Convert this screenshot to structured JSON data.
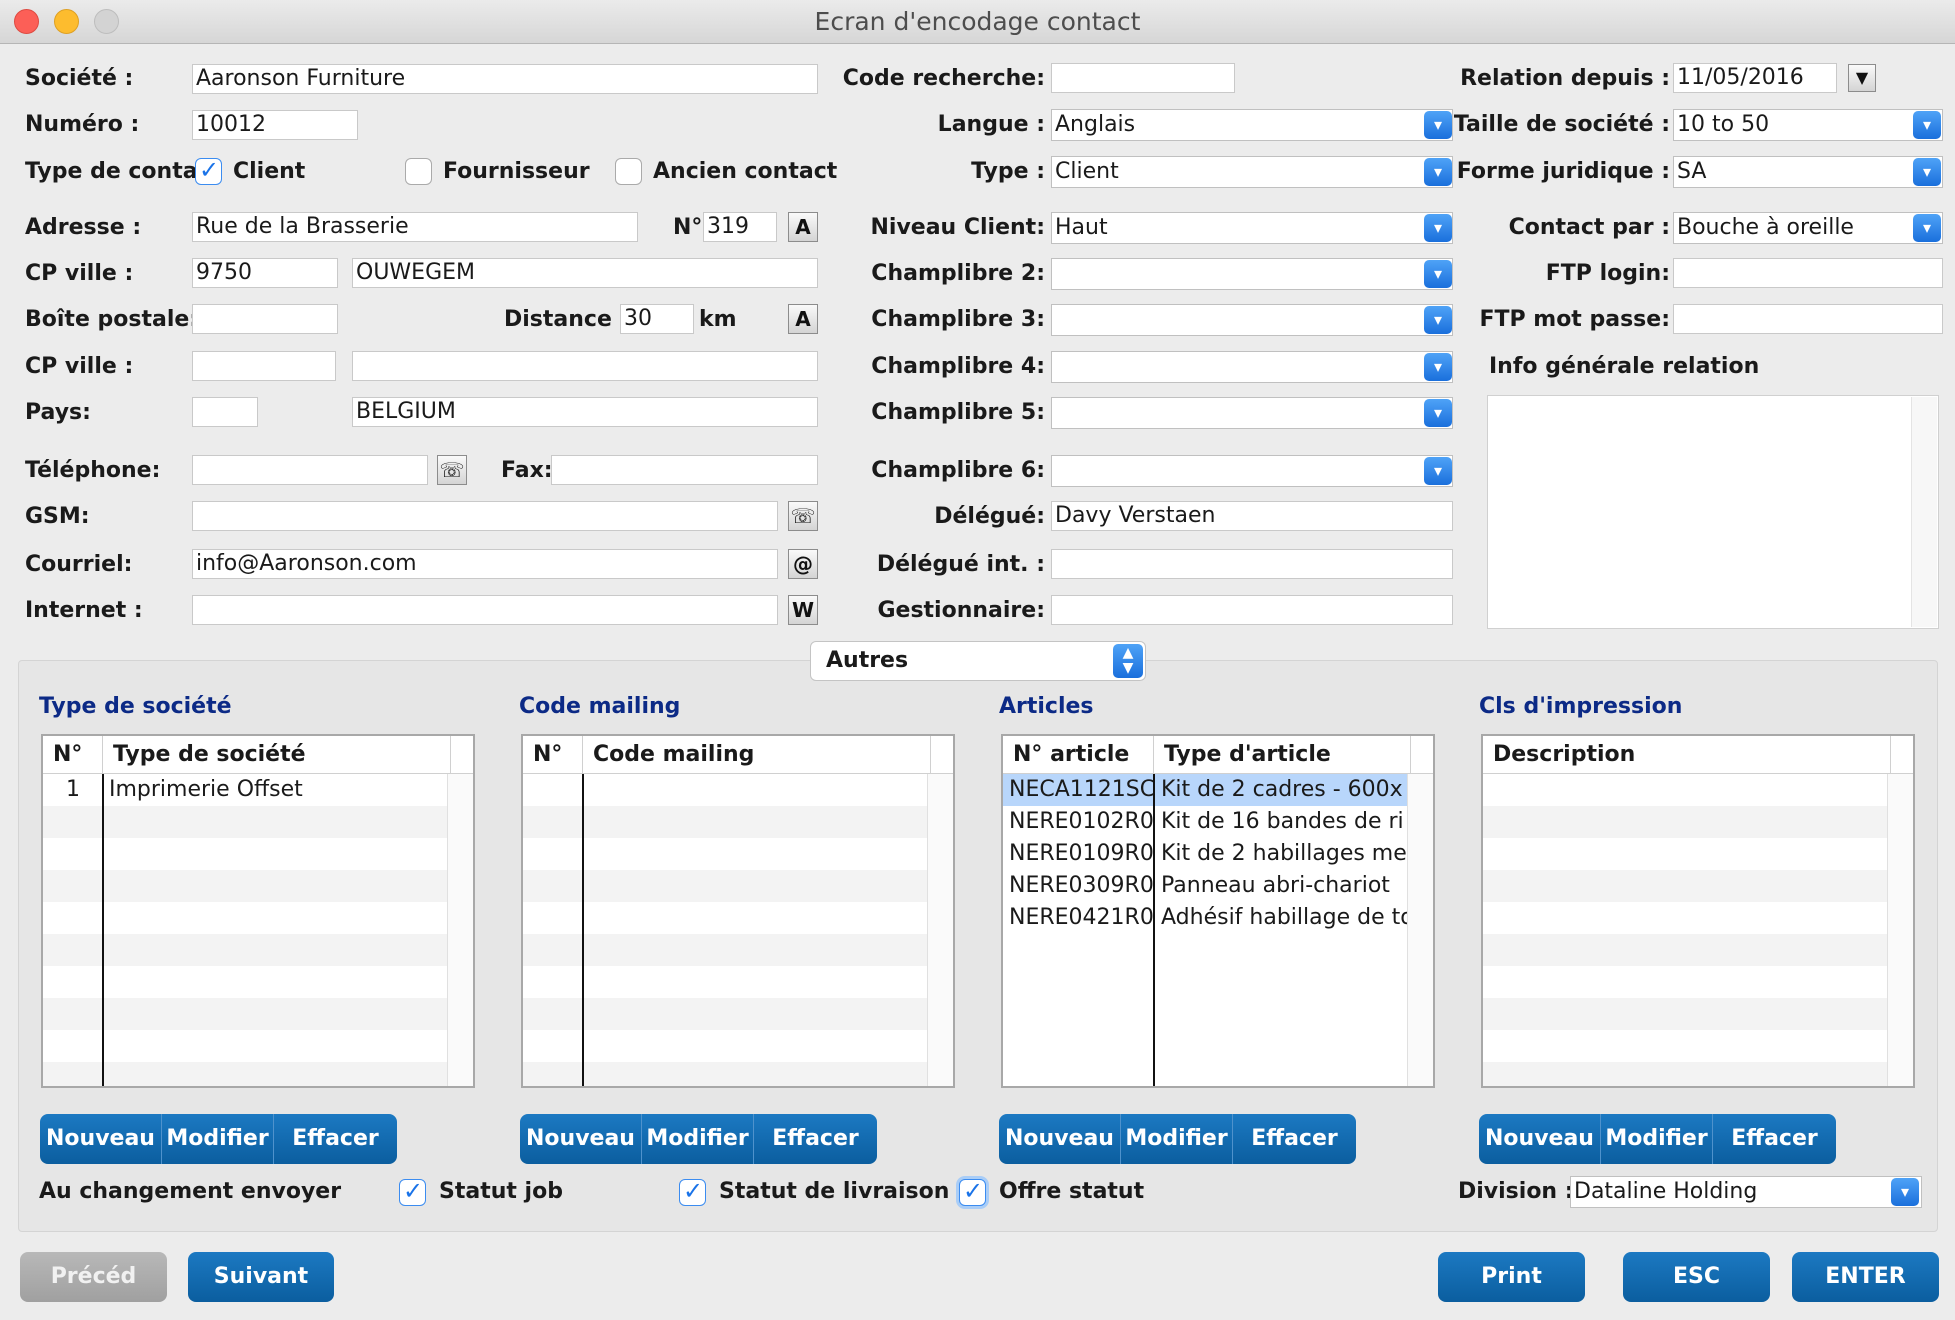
{
  "window": {
    "title": "Ecran d'encodage contact"
  },
  "left": {
    "societe_label": "Société :",
    "societe": "Aaronson Furniture",
    "numero_label": "Numéro :",
    "numero": "10012",
    "type_contact_label": "Type de contact",
    "client_label": "Client",
    "fournisseur_label": "Fournisseur",
    "ancien_label": "Ancien contact",
    "adresse_label": "Adresse :",
    "adresse": "Rue de la Brasserie",
    "no_label": "N°",
    "no": "319",
    "cpville_label": "CP ville :",
    "cp": "9750",
    "ville": "OUWEGEM",
    "boite_label": "Boîte postale:",
    "boite": "",
    "distance_label": "Distance :",
    "distance": "30",
    "km_label": "km",
    "cpville2_label": "CP ville :",
    "cp2": "",
    "ville2": "",
    "pays_label": "Pays:",
    "pays_code": "",
    "pays": "BELGIUM",
    "telephone_label": "Téléphone:",
    "telephone": "",
    "fax_label": "Fax:",
    "fax": "",
    "gsm_label": "GSM:",
    "gsm": "",
    "courriel_label": "Courriel:",
    "courriel": "info@Aaronson.com",
    "internet_label": "Internet :",
    "internet": "",
    "icon_a": "A",
    "icon_dist": "A",
    "icon_phone": "☏",
    "icon_at": "@",
    "icon_w": "W"
  },
  "middle": {
    "code_recherche_label": "Code recherche:",
    "code_recherche": "",
    "langue_label": "Langue :",
    "langue": "Anglais",
    "type_label": "Type :",
    "type": "Client",
    "niveau_label": "Niveau Client:",
    "niveau": "Haut",
    "cl2_label": "Champlibre 2:",
    "cl2": "",
    "cl3_label": "Champlibre 3:",
    "cl3": "",
    "cl4_label": "Champlibre 4:",
    "cl4": "",
    "cl5_label": "Champlibre 5:",
    "cl5": "",
    "cl6_label": "Champlibre 6:",
    "cl6": "",
    "delegue_label": "Délégué:",
    "delegue": "Davy Verstaen",
    "delegue_int_label": "Délégué int. :",
    "delegue_int": "",
    "gestionnaire_label": "Gestionnaire:",
    "gestionnaire": ""
  },
  "right": {
    "relation_label": "Relation depuis :",
    "relation": "11/05/2016",
    "taille_label": "Taille de société :",
    "taille": "10 to 50",
    "forme_label": "Forme juridique :",
    "forme": "SA",
    "contact_par_label": "Contact par :",
    "contact_par": "Bouche à oreille",
    "ftp_login_label": "FTP login:",
    "ftp_login": "",
    "ftp_pass_label": "FTP mot passe:",
    "ftp_pass": "",
    "info_label": "Info générale relation",
    "info": ""
  },
  "autres": {
    "label": "Autres"
  },
  "sections": {
    "type_societe": {
      "title": "Type de société",
      "headers": [
        "N°",
        "Type de société"
      ],
      "rows": [
        [
          "1",
          "Imprimerie Offset"
        ]
      ]
    },
    "code_mailing": {
      "title": "Code mailing",
      "headers": [
        "N°",
        "Code mailing"
      ],
      "rows": []
    },
    "articles": {
      "title": "Articles",
      "headers": [
        "N° article",
        "Type d'article"
      ],
      "rows": [
        [
          "NECA1121SC",
          "Kit de 2 cadres - 600x"
        ],
        [
          "NERE0102R0",
          "Kit de 16 bandes de ri"
        ],
        [
          "NERE0109R0",
          "Kit de 2 habillages me"
        ],
        [
          "NERE0309R0",
          "Panneau abri-chariot"
        ],
        [
          "NERE0421R0",
          "Adhésif habillage de to"
        ]
      ]
    },
    "cls_impression": {
      "title": "Cls d'impression",
      "headers": [
        "Description"
      ],
      "rows": []
    }
  },
  "buttons": {
    "nouveau": "Nouveau",
    "modifier": "Modifier",
    "effacer": "Effacer",
    "preced": "Précéd",
    "suivant": "Suivant",
    "print": "Print",
    "esc": "ESC",
    "enter": "ENTER"
  },
  "bottom": {
    "au_changement": "Au changement envoyer",
    "statut_job": "Statut job",
    "statut_livraison": "Statut de livraison",
    "offre_statut": "Offre statut",
    "division_label": "Division :",
    "division": "Dataline Holding"
  },
  "colors": {
    "accent": "#1a73e8",
    "button": "#0b5e9f",
    "section_title": "#0c2a86"
  }
}
